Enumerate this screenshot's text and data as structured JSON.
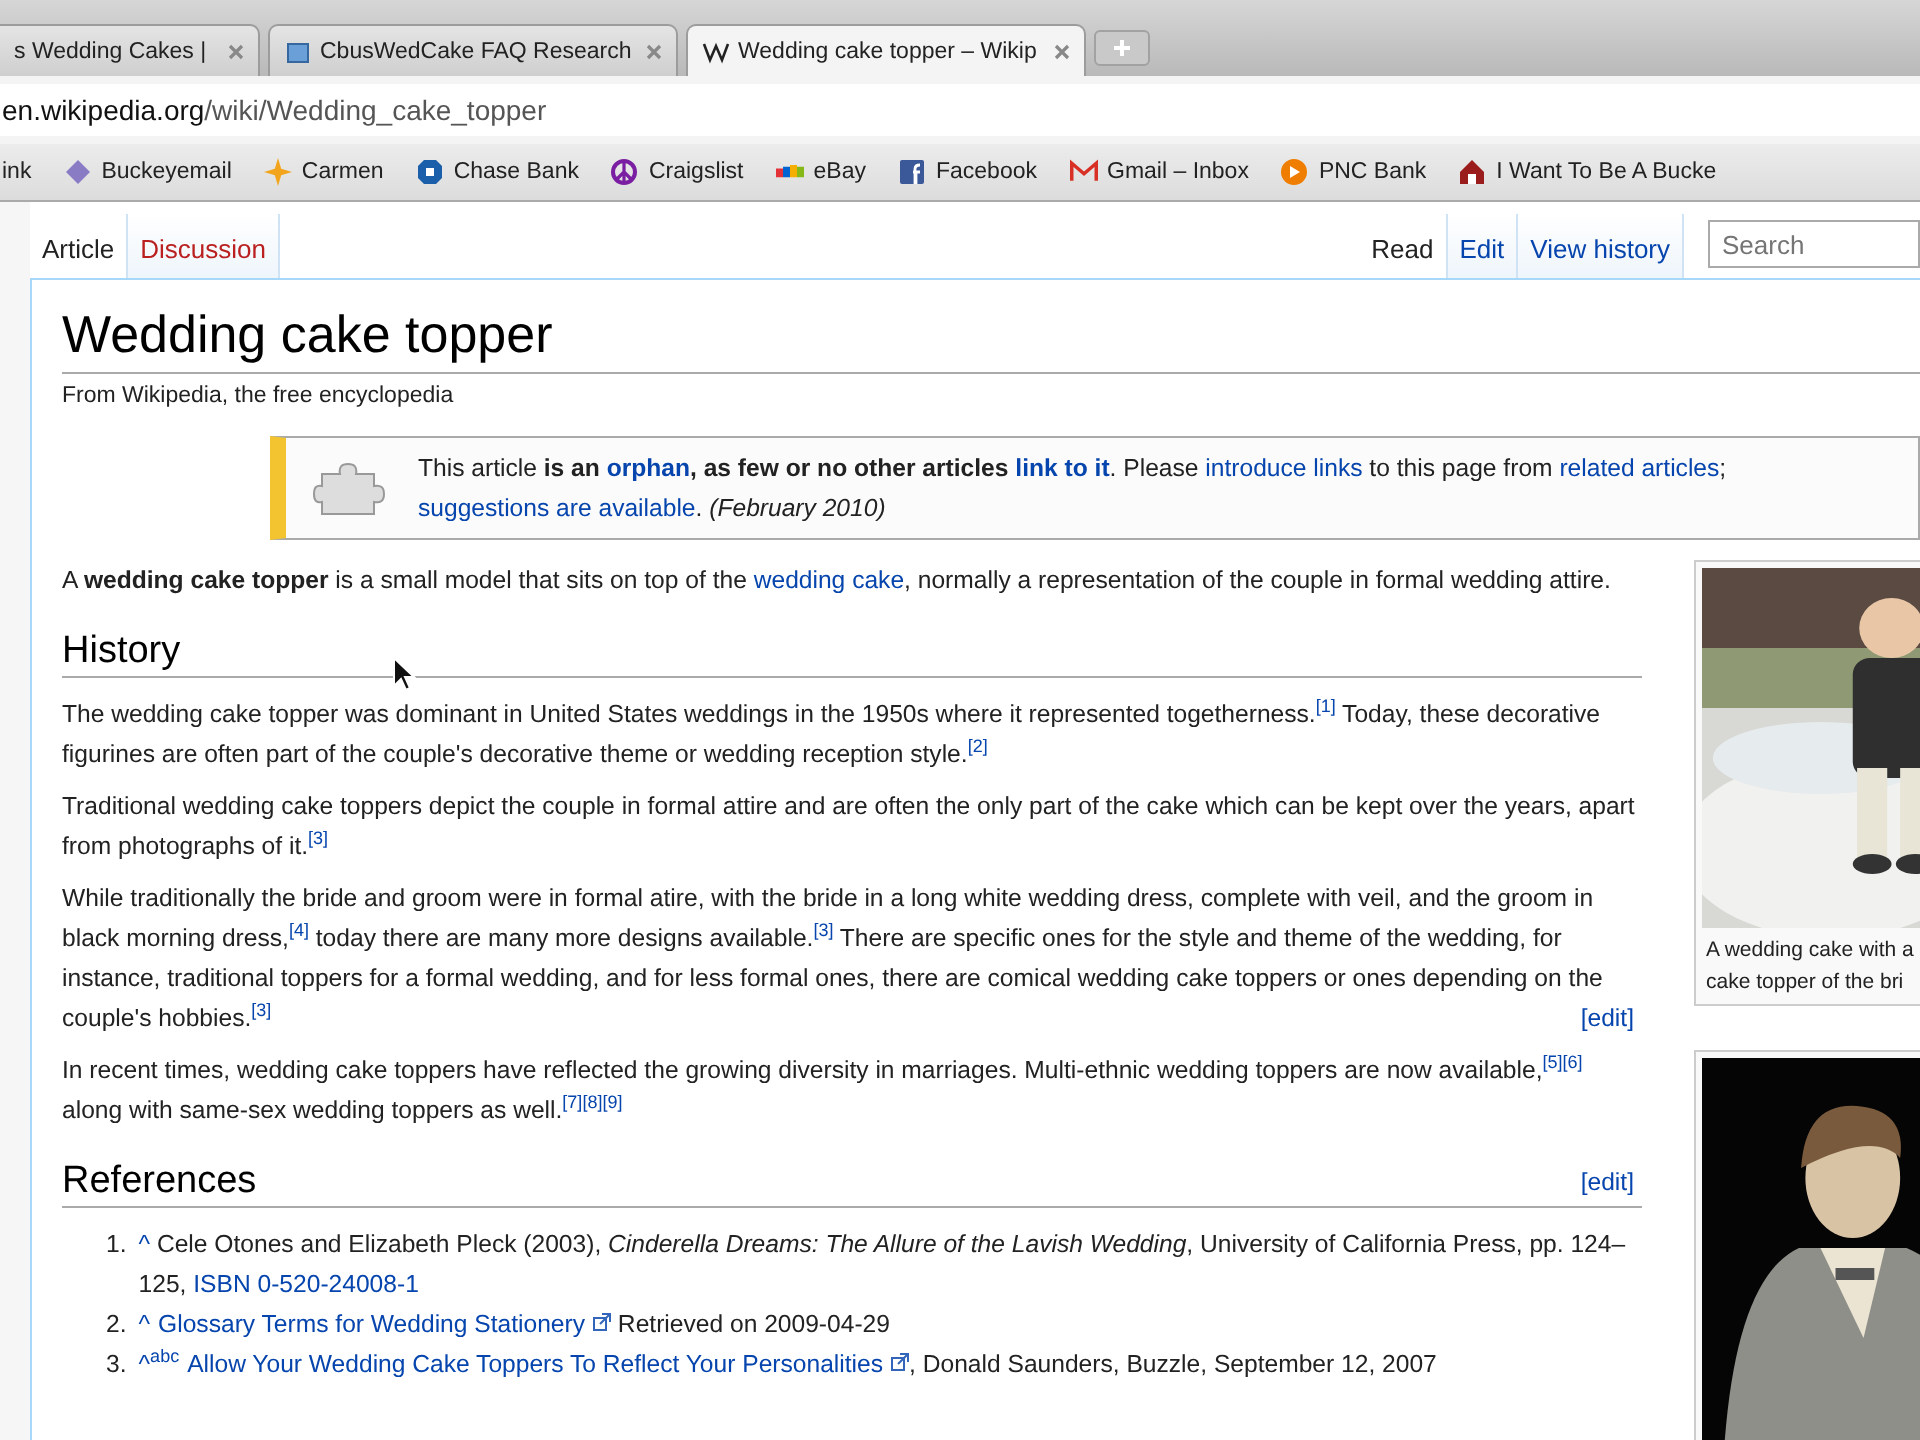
{
  "browser": {
    "tabs": [
      {
        "title": "s Wedding Cakes |",
        "selected": false
      },
      {
        "title": "CbusWedCake FAQ Research",
        "selected": false
      },
      {
        "title": "Wedding cake topper – Wikip",
        "selected": true
      }
    ],
    "address": {
      "host": "en.wikipedia.org",
      "path": "/wiki/Wedding_cake_topper"
    },
    "bookmarks": [
      "ink",
      "Buckeyemail",
      "Carmen",
      "Chase Bank",
      "Craigslist",
      "eBay",
      "Facebook",
      "Gmail – Inbox",
      "PNC Bank",
      "I Want To Be A Bucke"
    ]
  },
  "wiki": {
    "left_tabs": [
      {
        "label": "Article",
        "selected": true
      },
      {
        "label": "Discussion",
        "selected": false
      }
    ],
    "right_tabs": [
      {
        "label": "Read",
        "selected": true
      },
      {
        "label": "Edit",
        "selected": false
      },
      {
        "label": "View history",
        "selected": false
      }
    ],
    "search": {
      "placeholder": "Search"
    },
    "title": "Wedding cake topper",
    "subtitle": "From Wikipedia, the free encyclopedia",
    "notice": {
      "lines": [
        [
          {
            "kind": "text",
            "text": "This article **is an** "
          },
          {
            "kind": "link",
            "text": "**orphan**"
          },
          {
            "kind": "text",
            "text": "**, as few or no other articles** "
          },
          {
            "kind": "link",
            "text": "**link to it**"
          },
          {
            "kind": "text",
            "text": ". Please "
          },
          {
            "kind": "link",
            "text": "introduce links"
          },
          {
            "kind": "text",
            "text": " to this page from "
          },
          {
            "kind": "link",
            "text": "related articles"
          },
          {
            "kind": "text",
            "text": ";"
          }
        ],
        [
          {
            "kind": "link",
            "text": "suggestions are available"
          },
          {
            "kind": "text",
            "text": ". *(February 2010)*"
          }
        ]
      ]
    },
    "intro": [
      {
        "kind": "text",
        "text": "A **wedding cake topper** is a small model that sits on top of the "
      },
      {
        "kind": "link",
        "text": "wedding cake"
      },
      {
        "kind": "text",
        "text": ", normally a representation of the couple in formal wedding attire."
      }
    ],
    "sections": [
      {
        "heading": "History",
        "paragraphs": [
          {
            "segments": [
              {
                "kind": "text",
                "text": "The wedding cake topper was dominant in United States weddings in the 1950s where it represented togetherness."
              },
              {
                "kind": "link",
                "text": "$^{[1]}$"
              },
              {
                "kind": "text",
                "text": " Today, these decorative figurines are often part of the couple's decorative theme or wedding reception style."
              },
              {
                "kind": "link",
                "text": "$^{[2]}$"
              }
            ]
          },
          {
            "segments": [
              {
                "kind": "text",
                "text": "Traditional wedding cake toppers depict the couple in formal attire and are often the only part of the cake which can be kept over the years, apart from photographs of it."
              },
              {
                "kind": "link",
                "text": "$^{[3]}$"
              }
            ]
          },
          {
            "segments": [
              {
                "kind": "text",
                "text": "While traditionally the bride and groom were in formal atire, with the bride in a long white wedding dress, complete with veil, and the groom in black morning dress,"
              },
              {
                "kind": "link",
                "text": "$^{[4]}$"
              },
              {
                "kind": "text",
                "text": " today there are many more designs available."
              },
              {
                "kind": "link",
                "text": "$^{[3]}$"
              },
              {
                "kind": "text",
                "text": " There are specific ones for the style and theme of the wedding, for instance, traditional toppers for a formal wedding, and for less formal ones, there are comical wedding cake toppers or ones depending on the couple's hobbies."
              },
              {
                "kind": "link",
                "text": "$^{[3]}$"
              }
            ],
            "edit": "[edit]"
          },
          {
            "segments": [
              {
                "kind": "text",
                "text": "In recent times, wedding cake toppers have reflected the growing diversity in marriages. Multi-ethnic wedding toppers are now available,"
              },
              {
                "kind": "link",
                "text": "$^{[5]}$"
              },
              {
                "kind": "link",
                "text": "$^{[6]}$"
              },
              {
                "kind": "text",
                "text": " along with same-sex wedding toppers as well."
              },
              {
                "kind": "link",
                "text": "$^{[7]}$"
              },
              {
                "kind": "link",
                "text": "$^{[8]}$"
              },
              {
                "kind": "link",
                "text": "$^{[9]}$"
              }
            ]
          }
        ]
      },
      {
        "heading": "References",
        "edit": "[edit]"
      }
    ],
    "references": [
      {
        "number": "1.",
        "segments": [
          {
            "kind": "link",
            "text": "^"
          },
          {
            "kind": "text",
            "text": " Cele Otones and Elizabeth Pleck (2003), *Cinderella Dreams: The Allure of the Lavish Wedding*, University of California Press, pp. 124–125, "
          },
          {
            "kind": "link",
            "text": "ISBN 0-520-24008-1"
          }
        ]
      },
      {
        "number": "2.",
        "segments": [
          {
            "kind": "link",
            "text": "^"
          },
          {
            "kind": "extlink",
            "text": "Glossary Terms for Wedding Stationery"
          },
          {
            "kind": "text",
            "text": " Retrieved on 2009-04-29"
          }
        ]
      },
      {
        "number": "3.",
        "segments": [
          {
            "kind": "link",
            "text": "^"
          },
          {
            "kind": "link",
            "text": "$^{a}$"
          },
          {
            "kind": "link",
            "text": "$^{b}$"
          },
          {
            "kind": "link",
            "text": "$^{c}$"
          },
          {
            "kind": "extlink",
            "text": "Allow Your Wedding Cake Toppers To Reflect Your Personalities"
          },
          {
            "kind": "text",
            "text": ", Donald Saunders, Buzzle, September 12, 2007"
          }
        ]
      }
    ],
    "thumbs": [
      {
        "kind": "picture",
        "caption_lines": [
          "A wedding cake with a",
          "cake topper of the bri"
        ]
      },
      {
        "kind": "picture"
      }
    ]
  }
}
